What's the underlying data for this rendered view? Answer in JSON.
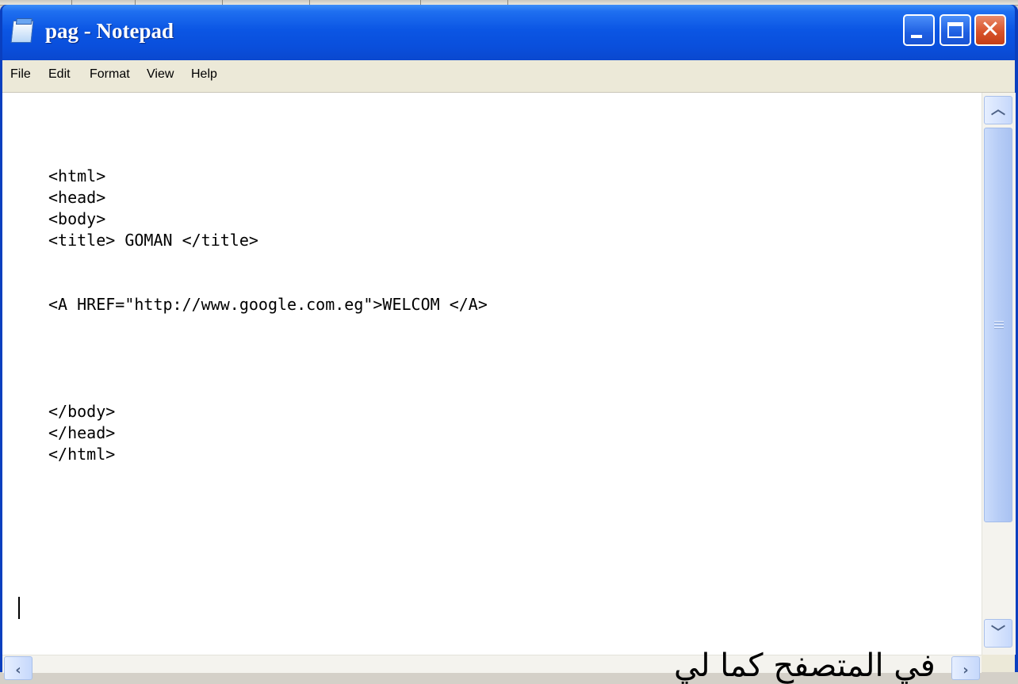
{
  "window": {
    "title": "pag - Notepad",
    "controls": {
      "minimize_label": "minimize",
      "maximize_label": "maximize",
      "close_label": "close"
    }
  },
  "menu": {
    "items": [
      "File",
      "Edit",
      "Format",
      "View",
      "Help"
    ]
  },
  "editor": {
    "content": "<html>\n<head>\n<body>\n<title> GOMAN </title>\n\n\n<A HREF=\"http://www.google.com.eg\">WELCOM </A>\n\n\n\n\n</body>\n</head>\n</html>"
  },
  "overlay": {
    "text": "في المتصفح كما لي"
  },
  "icons": {
    "app": "notepad-icon",
    "scroll_up": "chevron-up-icon",
    "scroll_down": "chevron-down-icon",
    "scroll_left": "chevron-left-icon",
    "scroll_right": "chevron-right-icon"
  },
  "colors": {
    "titlebar": "#0a55e0",
    "close_button": "#d8532b",
    "menubar": "#ece9d8",
    "editor_bg": "#ffffff",
    "scrollbar_thumb": "#b7cdf6"
  }
}
